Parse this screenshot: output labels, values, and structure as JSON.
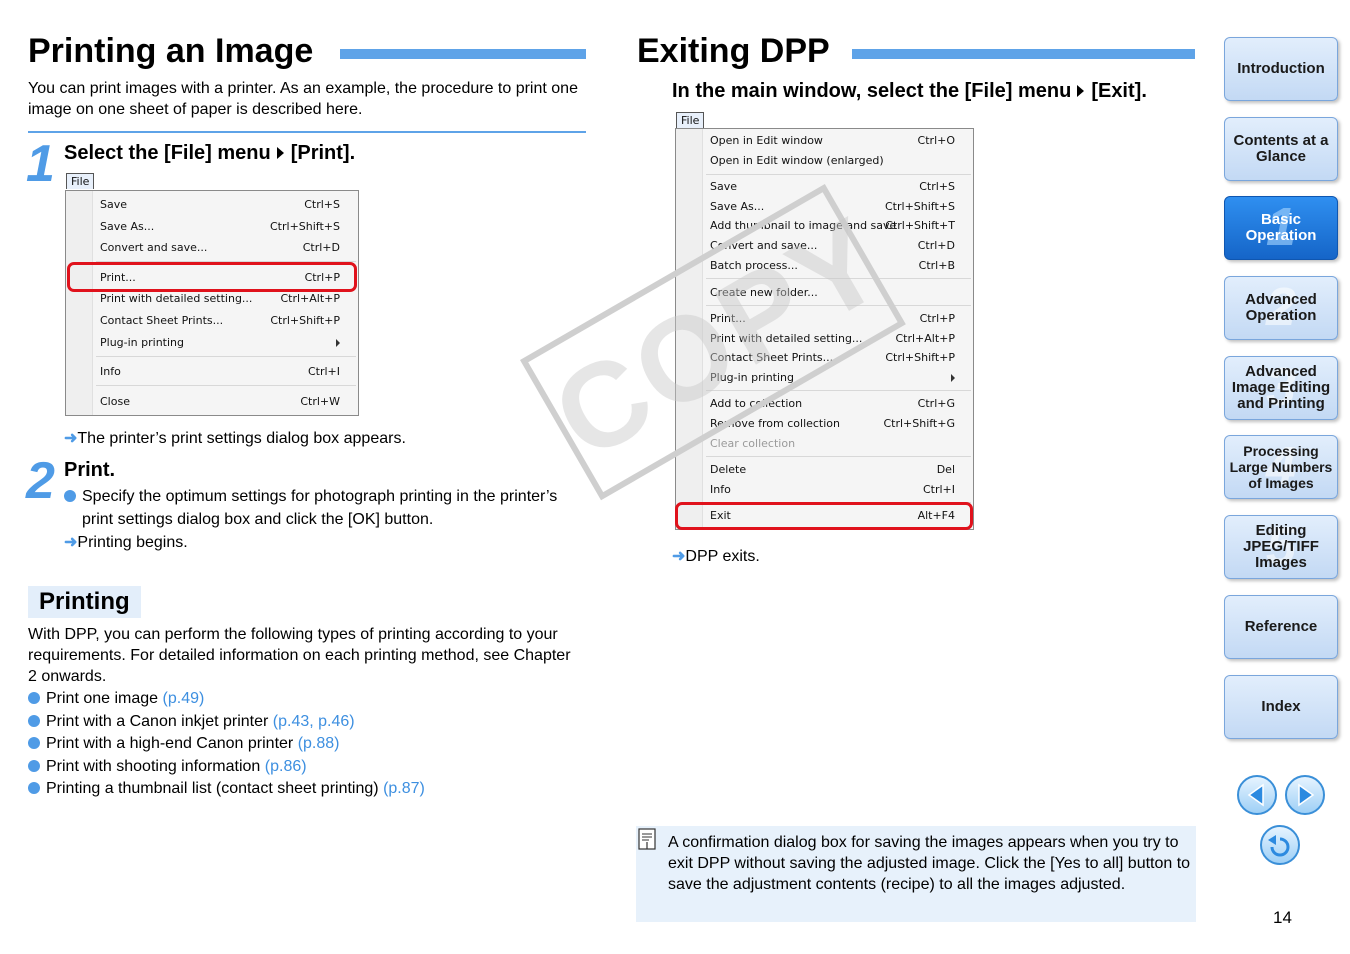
{
  "left": {
    "title": "Printing an Image",
    "intro": "You can print images with a printer. As an example, the procedure to print one image on one sheet of paper is described here.",
    "step1": {
      "num": "1",
      "title_a": "Select the [File] menu",
      "title_b": "[Print].",
      "menu_tab": "File",
      "menu_items": [
        {
          "label": "Save",
          "shortcut": "Ctrl+S"
        },
        {
          "label": "Save As...",
          "shortcut": "Ctrl+Shift+S"
        },
        {
          "label": "Convert and save...",
          "shortcut": "Ctrl+D"
        },
        {
          "label": "Print...",
          "shortcut": "Ctrl+P"
        },
        {
          "label": "Print with detailed setting...",
          "shortcut": "Ctrl+Alt+P"
        },
        {
          "label": "Contact Sheet Prints...",
          "shortcut": "Ctrl+Shift+P"
        },
        {
          "label": "Plug-in printing",
          "shortcut": ""
        },
        {
          "label": "Info",
          "shortcut": "Ctrl+I"
        },
        {
          "label": "Close",
          "shortcut": "Ctrl+W"
        }
      ],
      "result": "The printer’s print settings dialog box appears."
    },
    "step2": {
      "num": "2",
      "title": "Print.",
      "bullet": "Specify the optimum settings for photograph printing in the printer’s print settings dialog box and click the [OK] button.",
      "result": "Printing begins."
    },
    "printing": {
      "heading": "Printing",
      "text": "With DPP, you can perform the following types of printing according to your requirements. For detailed information on each printing method, see Chapter 2 onwards.",
      "items": [
        {
          "text": "Print one image",
          "ref": "(p.49)"
        },
        {
          "text": "Print with a Canon inkjet printer",
          "ref": "(p.43, p.46)"
        },
        {
          "text": "Print with a high-end Canon printer",
          "ref": "(p.88)"
        },
        {
          "text": "Print with shooting information",
          "ref": "(p.86)"
        },
        {
          "text": "Printing a thumbnail list (contact sheet printing)",
          "ref": "(p.87)"
        }
      ]
    }
  },
  "right": {
    "title": "Exiting DPP",
    "instruction_a": "In the main window, select the [File] menu",
    "instruction_b": "[Exit].",
    "menu_tab": "File",
    "menu_items": [
      {
        "label": "Open in Edit window",
        "shortcut": "Ctrl+O"
      },
      {
        "label": "Open in Edit window (enlarged)",
        "shortcut": ""
      },
      {
        "label": "Save",
        "shortcut": "Ctrl+S"
      },
      {
        "label": "Save As...",
        "shortcut": "Ctrl+Shift+S"
      },
      {
        "label": "Add thumbnail to image and save",
        "shortcut": "Ctrl+Shift+T"
      },
      {
        "label": "Convert and save...",
        "shortcut": "Ctrl+D"
      },
      {
        "label": "Batch process...",
        "shortcut": "Ctrl+B"
      },
      {
        "label": "Create new folder...",
        "shortcut": ""
      },
      {
        "label": "Print...",
        "shortcut": "Ctrl+P"
      },
      {
        "label": "Print with detailed setting...",
        "shortcut": "Ctrl+Alt+P"
      },
      {
        "label": "Contact Sheet Prints...",
        "shortcut": "Ctrl+Shift+P"
      },
      {
        "label": "Plug-in printing",
        "shortcut": ""
      },
      {
        "label": "Add to collection",
        "shortcut": "Ctrl+G"
      },
      {
        "label": "Remove from collection",
        "shortcut": "Ctrl+Shift+G"
      },
      {
        "label": "Clear collection",
        "shortcut": ""
      },
      {
        "label": "Delete",
        "shortcut": "Del"
      },
      {
        "label": "Info",
        "shortcut": "Ctrl+I"
      },
      {
        "label": "Exit",
        "shortcut": "Alt+F4"
      }
    ],
    "result": "DPP exits.",
    "note": "A confirmation dialog box for saving the images appears when you try to exit DPP without saving the adjusted image. Click the [Yes to all] button to save the adjustment contents (recipe) to all the images adjusted."
  },
  "watermark": "COPY",
  "nav": {
    "items": [
      {
        "label": "Introduction",
        "num": ""
      },
      {
        "label": "Contents at a Glance",
        "num": ""
      },
      {
        "label": "Basic Operation",
        "num": "1"
      },
      {
        "label": "Advanced Operation",
        "num": "2"
      },
      {
        "label": "Advanced Image Editing and Printing",
        "num": "3"
      },
      {
        "label": "Processing Large Numbers of Images",
        "num": "4"
      },
      {
        "label": "Editing JPEG/TIFF Images",
        "num": "5"
      },
      {
        "label": "Reference",
        "num": ""
      },
      {
        "label": "Index",
        "num": ""
      }
    ]
  },
  "page_number": "14",
  "colors": {
    "accent": "#4f9be6",
    "highlight": "#e0121c",
    "nav_active": "#1f7ae0"
  }
}
